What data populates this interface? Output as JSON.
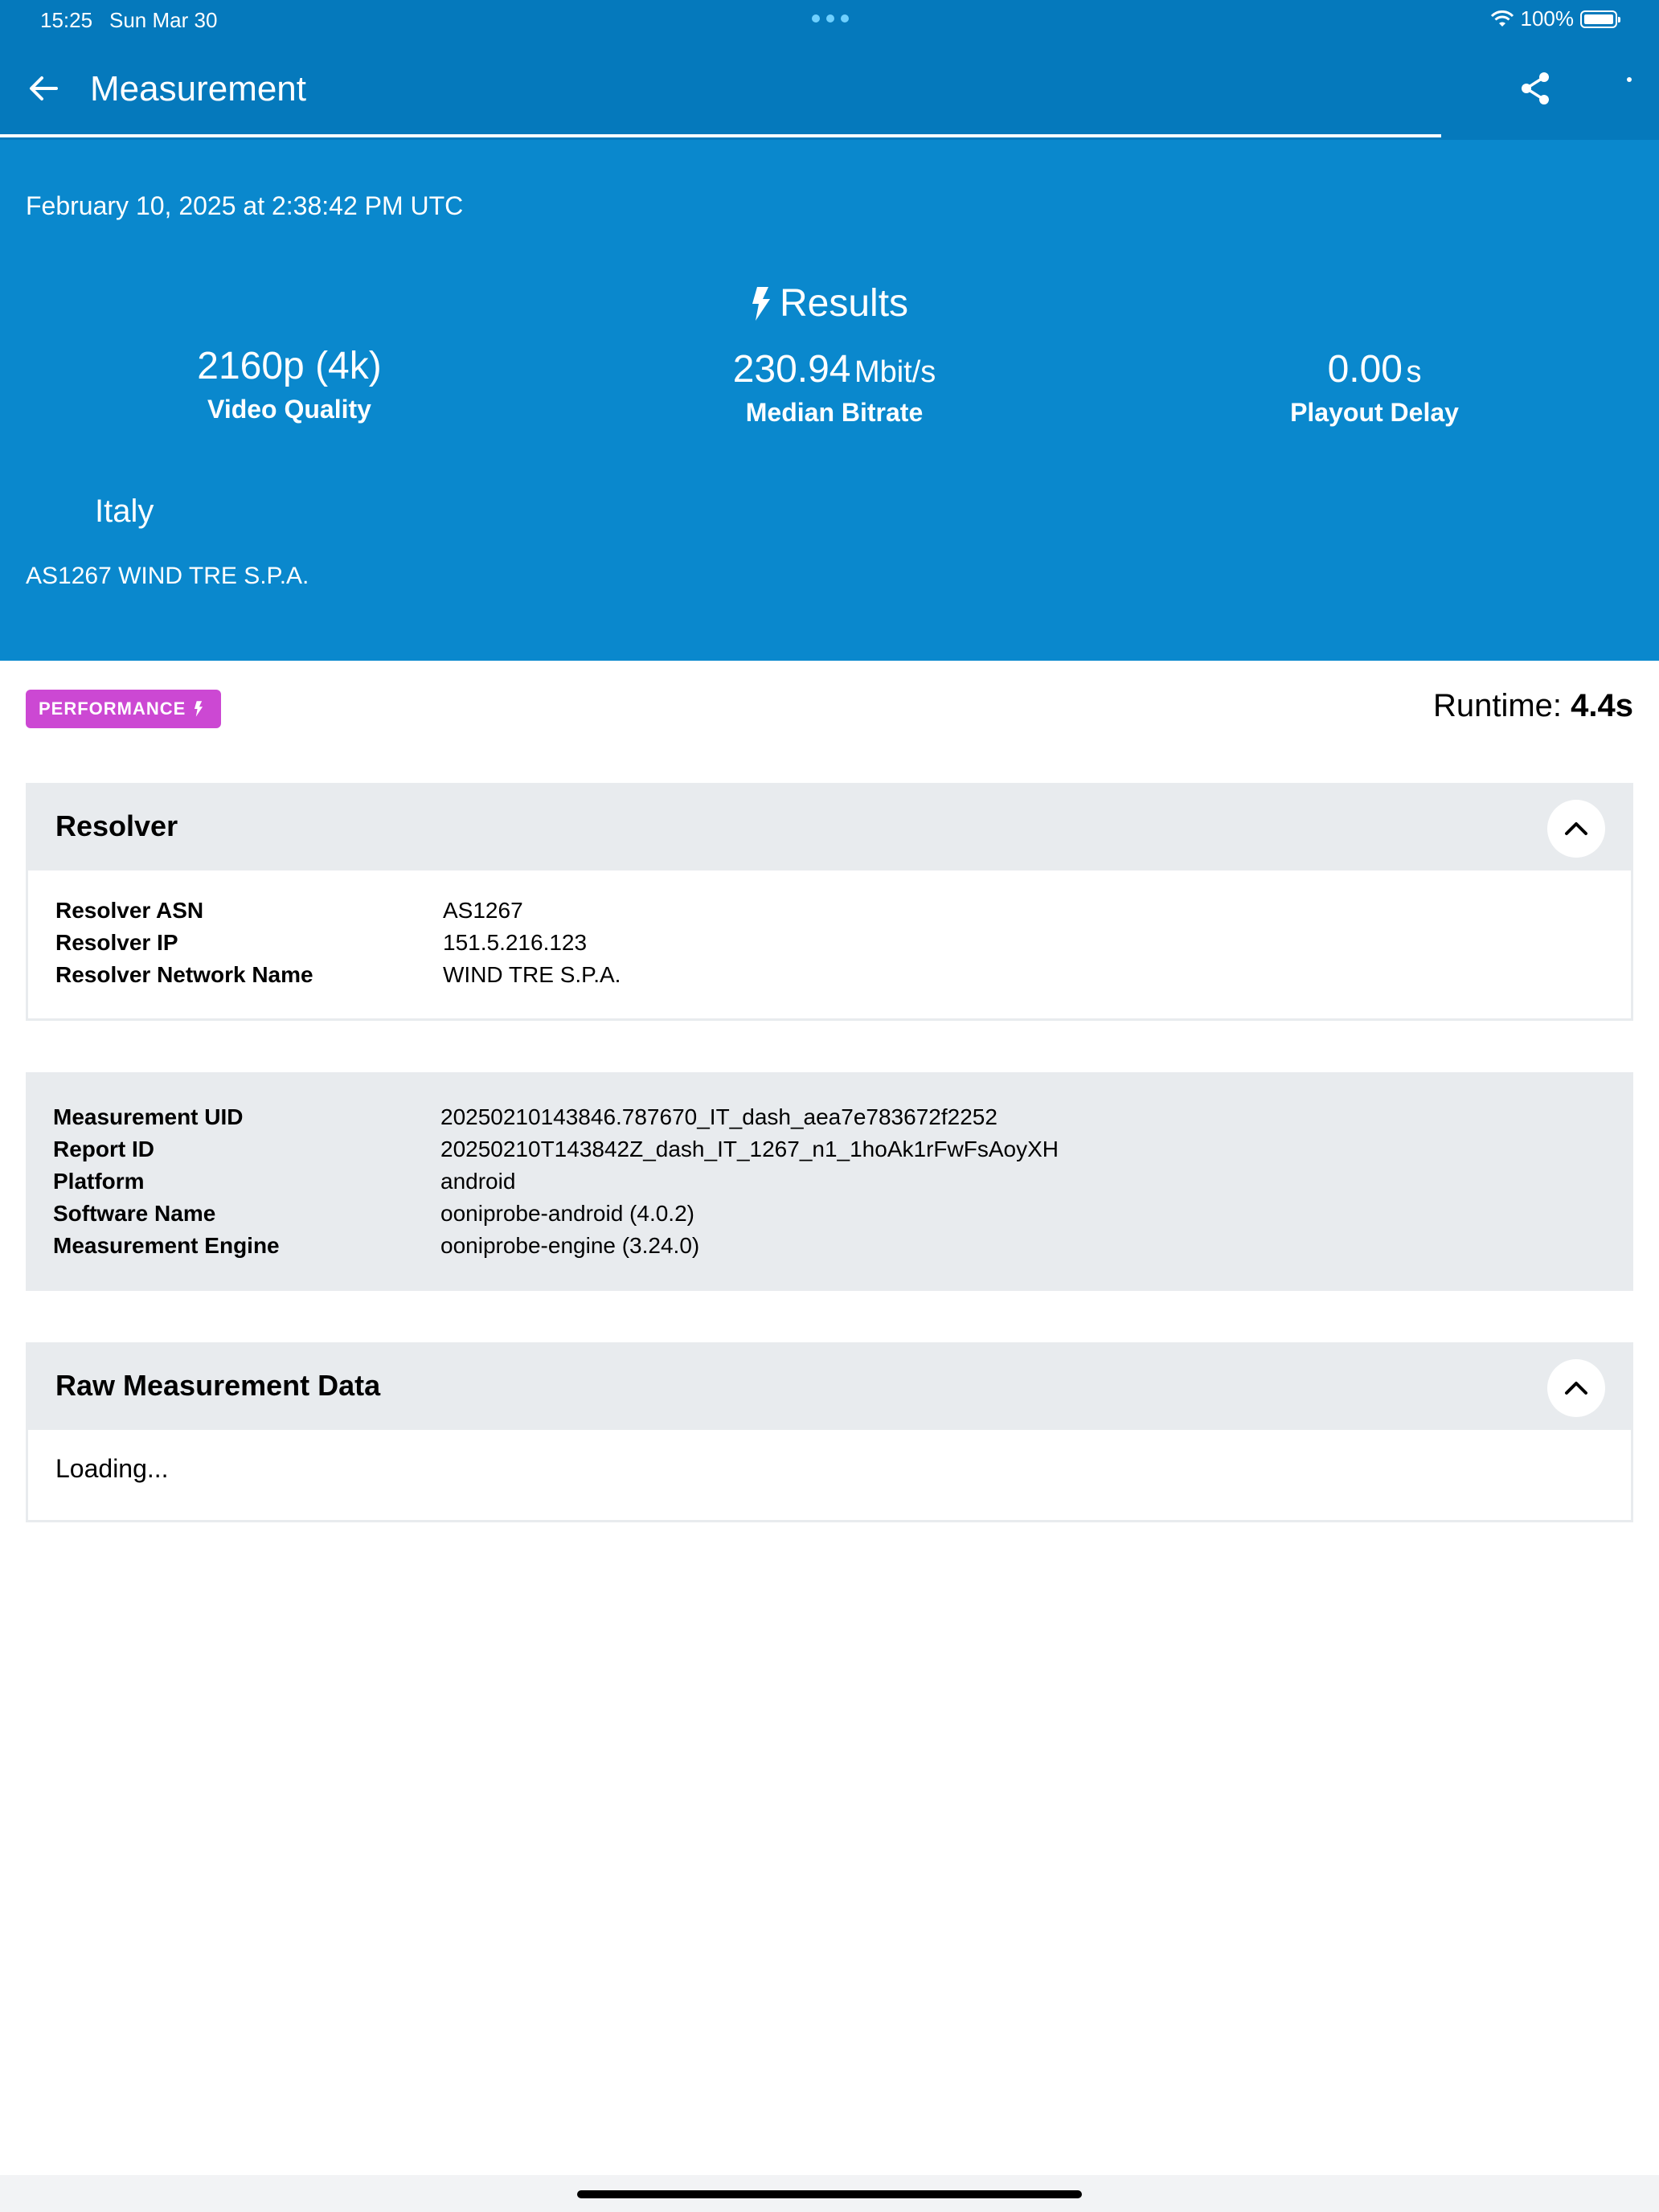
{
  "status_bar": {
    "time": "15:25",
    "date": "Sun Mar 30",
    "battery": "100%"
  },
  "app_bar": {
    "title": "Measurement",
    "back_icon": "arrow-left-icon",
    "share_icon": "share-icon"
  },
  "header": {
    "date": "February 10, 2025 at 2:38:42 PM UTC",
    "results_title": "Results",
    "metrics": [
      {
        "value": "2160p (4k)",
        "unit": "",
        "label": "Video Quality"
      },
      {
        "value": "230.94",
        "unit": "Mbit/s",
        "label": "Median Bitrate"
      },
      {
        "value": "0.00",
        "unit": "s",
        "label": "Playout Delay"
      }
    ],
    "country": "Italy",
    "network": "AS1267 WIND TRE S.P.A."
  },
  "badge": {
    "label": "PERFORMANCE",
    "color": "#cc48d3"
  },
  "runtime": {
    "label": "Runtime:",
    "value": "4.4s"
  },
  "resolver": {
    "title": "Resolver",
    "rows": [
      {
        "key": "Resolver ASN",
        "value": "AS1267"
      },
      {
        "key": "Resolver IP",
        "value": "151.5.216.123"
      },
      {
        "key": "Resolver Network Name",
        "value": "WIND TRE S.P.A."
      }
    ]
  },
  "meta": {
    "rows": [
      {
        "key": "Measurement UID",
        "value": "20250210143846.787670_IT_dash_aea7e783672f2252"
      },
      {
        "key": "Report ID",
        "value": "20250210T143842Z_dash_IT_1267_n1_1hoAk1rFwFsAoyXH"
      },
      {
        "key": "Platform",
        "value": "android"
      },
      {
        "key": "Software Name",
        "value": "ooniprobe-android (4.0.2)"
      },
      {
        "key": "Measurement Engine",
        "value": "ooniprobe-engine (3.24.0)"
      }
    ]
  },
  "raw": {
    "title": "Raw Measurement Data",
    "loading": "Loading..."
  },
  "colors": {
    "app_bar": "#0579bc",
    "header": "#0a88cd",
    "section_bg": "#e8ebee"
  }
}
